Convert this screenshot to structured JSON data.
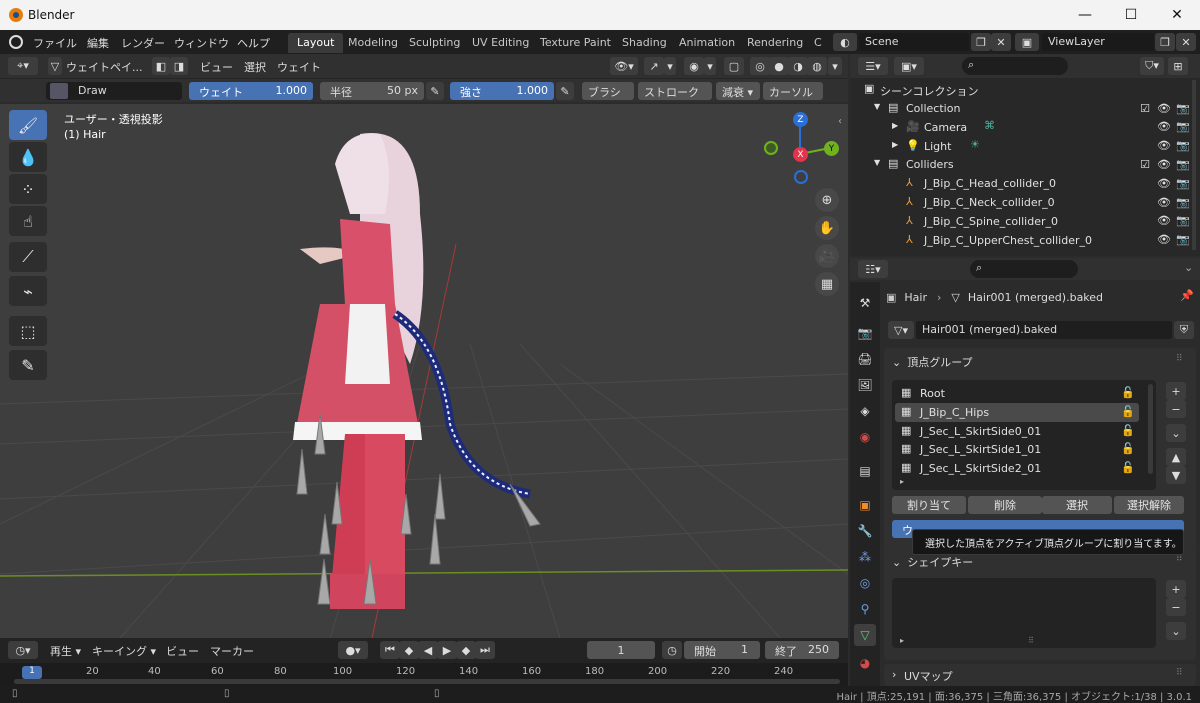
{
  "window": {
    "app_name": "Blender",
    "minimize": "—",
    "maximize": "☐",
    "close": "✕"
  },
  "menu": {
    "items": [
      "ファイル",
      "編集",
      "レンダー",
      "ウィンドウ",
      "ヘルプ"
    ],
    "workspaces": [
      "Layout",
      "Modeling",
      "Sculpting",
      "UV Editing",
      "Texture Paint",
      "Shading",
      "Animation",
      "Rendering",
      "C"
    ],
    "active_workspace": "Layout",
    "scene": "Scene",
    "view_layer": "ViewLayer"
  },
  "viewport_header": {
    "mode": "ウェイトペイ...",
    "menus": [
      "ビュー",
      "選択",
      "ウェイト"
    ]
  },
  "tool_settings": {
    "brush": "Draw",
    "weight_label": "ウェイト",
    "weight_value": "1.000",
    "radius_label": "半径",
    "radius_value": "50 px",
    "strength_label": "強さ",
    "strength_value": "1.000",
    "dropdowns": [
      "ブラシ",
      "ストローク",
      "減衰",
      "カーソル"
    ]
  },
  "viewport": {
    "projection": "ユーザー・透視投影",
    "object": "(1) Hair",
    "gizmo": {
      "x": "X",
      "y": "Y",
      "z": "Z"
    }
  },
  "timeline": {
    "playback": "再生",
    "keying": "キーイング",
    "view": "ビュー",
    "marker": "マーカー",
    "current_frame": "1",
    "start_label": "開始",
    "start": "1",
    "end_label": "終了",
    "end": "250",
    "ruler_ticks": [
      "1",
      "20",
      "40",
      "60",
      "80",
      "100",
      "120",
      "140",
      "160",
      "180",
      "200",
      "220",
      "240"
    ]
  },
  "outliner": {
    "search_placeholder": "",
    "root": "シーンコレクション",
    "rows": [
      {
        "label": "Collection",
        "kind": "collection",
        "depth": 0,
        "expanded": true
      },
      {
        "label": "Camera",
        "kind": "camera",
        "depth": 1
      },
      {
        "label": "Light",
        "kind": "light",
        "depth": 1
      },
      {
        "label": "Colliders",
        "kind": "collection",
        "depth": 0,
        "expanded": true
      },
      {
        "label": "J_Bip_C_Head_collider_0",
        "kind": "empty",
        "depth": 1
      },
      {
        "label": "J_Bip_C_Neck_collider_0",
        "kind": "empty",
        "depth": 1
      },
      {
        "label": "J_Bip_C_Spine_collider_0",
        "kind": "empty",
        "depth": 1
      },
      {
        "label": "J_Bip_C_UpperChest_collider_0",
        "kind": "empty",
        "depth": 1
      }
    ]
  },
  "properties": {
    "breadcrumb_object": "Hair",
    "breadcrumb_data": "Hair001 (merged).baked",
    "mesh_name": "Hair001 (merged).baked",
    "vertex_groups_title": "頂点グループ",
    "vertex_groups": [
      "Root",
      "J_Bip_C_Hips",
      "J_Sec_L_SkirtSide0_01",
      "J_Sec_L_SkirtSide1_01",
      "J_Sec_L_SkirtSide2_01"
    ],
    "active_group": "J_Bip_C_Hips",
    "assign": "割り当て",
    "remove": "削除",
    "select": "選択",
    "deselect": "選択解除",
    "weight_field_partial": "ウ",
    "tooltip": "選択した頂点をアクティブ頂点グループに割り当てます。",
    "shape_keys_title": "シェイプキー",
    "uv_maps_title": "UVマップ"
  },
  "statusbar": {
    "text": "Hair | 頂点:25,191 | 面:36,375 | 三角面:36,375 | オブジェクト:1/38 | 3.0.1"
  },
  "colors": {
    "accent": "#4772b3",
    "panel": "#2b2b2b",
    "viewport": "#3e3e3e",
    "x_axis": "#e4334a",
    "y_axis": "#6fb21e",
    "z_axis": "#2a6fd6"
  }
}
